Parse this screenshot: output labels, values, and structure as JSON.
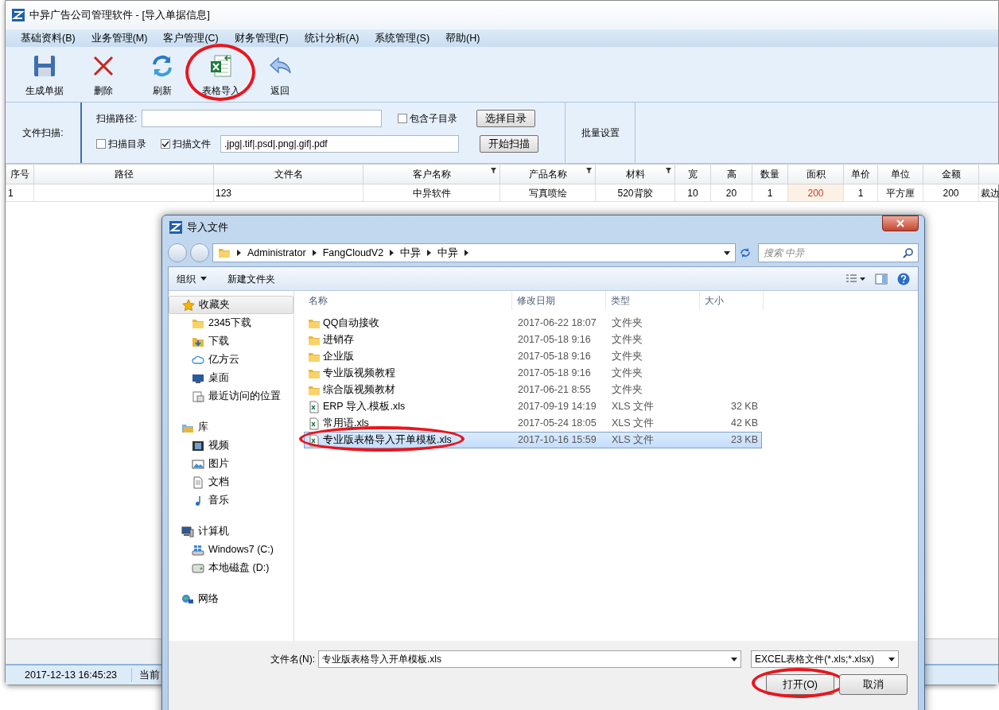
{
  "window": {
    "title": "中异广告公司管理软件 - [导入单据信息]"
  },
  "menu": [
    "基础资料(B)",
    "业务管理(M)",
    "客户管理(C)",
    "财务管理(F)",
    "统计分析(A)",
    "系统管理(S)",
    "帮助(H)"
  ],
  "toolbar": [
    {
      "label": "生成单据",
      "kind": "save",
      "circled": false
    },
    {
      "label": "删除",
      "kind": "delete",
      "circled": false
    },
    {
      "label": "刷新",
      "kind": "refresh",
      "circled": false
    },
    {
      "label": "表格导入",
      "kind": "excel",
      "circled": true
    },
    {
      "label": "返回",
      "kind": "back",
      "circled": false
    }
  ],
  "scan": {
    "label": "文件扫描:",
    "path_label": "扫描路径:",
    "include_subdirs": {
      "label": "包含子目录",
      "checked": false
    },
    "select_button": "选择目录",
    "scan_dir": {
      "label": "扫描目录",
      "checked": false
    },
    "scan_file": {
      "label": "扫描文件",
      "checked": true
    },
    "extensions": ".jpg|.tif|.psd|.png|.gif|.pdf",
    "start_button": "开始扫描",
    "batch_label": "批量设置"
  },
  "table": {
    "columns": [
      {
        "label": "序号",
        "filter": false,
        "highlighted": false
      },
      {
        "label": "路径",
        "filter": false,
        "highlighted": false
      },
      {
        "label": "文件名",
        "filter": false,
        "highlighted": false
      },
      {
        "label": "客户名称",
        "filter": true,
        "highlighted": false
      },
      {
        "label": "产品名称",
        "filter": true,
        "highlighted": false
      },
      {
        "label": "材料",
        "filter": true,
        "highlighted": false
      },
      {
        "label": "宽",
        "filter": false,
        "highlighted": false
      },
      {
        "label": "高",
        "filter": false,
        "highlighted": false
      },
      {
        "label": "数量",
        "filter": false,
        "highlighted": false
      },
      {
        "label": "面积",
        "filter": false,
        "highlighted": true
      },
      {
        "label": "单价",
        "filter": false,
        "highlighted": false
      },
      {
        "label": "单位",
        "filter": false,
        "highlighted": false
      },
      {
        "label": "金额",
        "filter": false,
        "highlighted": false
      },
      {
        "filter": false,
        "highlighted": false
      }
    ],
    "rows": [
      {
        "cells": [
          "1",
          null,
          "123",
          "中异软件",
          "写真喷绘",
          "520背胶",
          "10",
          "20",
          "1",
          "200",
          "1",
          "平方厘",
          "200",
          "裁边"
        ]
      }
    ]
  },
  "status_bar": {
    "datetime": "2017-12-13 16:45:23",
    "text": "当前"
  },
  "dialog": {
    "title": "导入文件",
    "breadcrumb": [
      "Administrator",
      "FangCloudV2",
      "中异",
      "中异"
    ],
    "search": {
      "placeholder": "搜索 中异"
    },
    "toolbar": [
      {
        "label": "组织",
        "dropdown": true
      },
      {
        "label": "新建文件夹",
        "dropdown": false
      }
    ],
    "nav": [
      {
        "label": "收藏夹",
        "kind": "star",
        "selected": true,
        "children": [
          {
            "label": "2345下载",
            "kind": "folder",
            "selected": false
          },
          {
            "label": "下载",
            "kind": "download",
            "selected": false
          },
          {
            "label": "亿方云",
            "kind": "cloud",
            "selected": false
          },
          {
            "label": "桌面",
            "kind": "desktop",
            "selected": false
          },
          {
            "label": "最近访问的位置",
            "kind": "recent",
            "selected": false
          }
        ]
      },
      {
        "label": "库",
        "kind": "library",
        "selected": false,
        "children": [
          {
            "label": "视频",
            "kind": "video",
            "selected": false
          },
          {
            "label": "图片",
            "kind": "picture",
            "selected": false
          },
          {
            "label": "文档",
            "kind": "document",
            "selected": false
          },
          {
            "label": "音乐",
            "kind": "music",
            "selected": false
          }
        ]
      },
      {
        "label": "计算机",
        "kind": "computer",
        "selected": false,
        "children": [
          {
            "label": "Windows7 (C:)",
            "kind": "sysdrive",
            "selected": false
          },
          {
            "label": "本地磁盘 (D:)",
            "kind": "drive",
            "selected": false
          }
        ]
      },
      {
        "label": "网络",
        "kind": "network",
        "selected": false
      }
    ],
    "columns": [
      "名称",
      "修改日期",
      "类型",
      "大小"
    ],
    "files": [
      {
        "name": "QQ自动接收",
        "modified": "2017-06-22 18:07",
        "type": "文件夹",
        "kind": "folder",
        "selected": false,
        "circled": false
      },
      {
        "name": "进销存",
        "modified": "2017-05-18 9:16",
        "type": "文件夹",
        "kind": "folder",
        "selected": false,
        "circled": false
      },
      {
        "name": "企业版",
        "modified": "2017-05-18 9:16",
        "type": "文件夹",
        "kind": "folder",
        "selected": false,
        "circled": false
      },
      {
        "name": "专业版视频教程",
        "modified": "2017-05-18 9:16",
        "type": "文件夹",
        "kind": "folder",
        "selected": false,
        "circled": false
      },
      {
        "name": "综合版视频教材",
        "modified": "2017-06-21 8:55",
        "type": "文件夹",
        "kind": "folder",
        "selected": false,
        "circled": false
      },
      {
        "name": "ERP 导入.模板.xls",
        "modified": "2017-09-19 14:19",
        "type": "XLS 文件",
        "size": "32 KB",
        "kind": "xls",
        "selected": false,
        "circled": false
      },
      {
        "name": "常用语.xls",
        "modified": "2017-05-24 18:05",
        "type": "XLS 文件",
        "size": "42 KB",
        "kind": "xls",
        "selected": false,
        "circled": false
      },
      {
        "name": "专业版表格导入开单模板.xls",
        "modified": "2017-10-16 15:59",
        "type": "XLS 文件",
        "size": "23 KB",
        "kind": "xls",
        "selected": true,
        "circled": true
      }
    ],
    "filename_label": "文件名(N):",
    "filename": "专业版表格导入开单模板.xls",
    "filetype": "EXCEL表格文件(*.xls;*.xlsx)",
    "buttons": [
      {
        "label": "打开(O)",
        "circled": true
      },
      {
        "label": "取消",
        "circled": false
      }
    ]
  }
}
